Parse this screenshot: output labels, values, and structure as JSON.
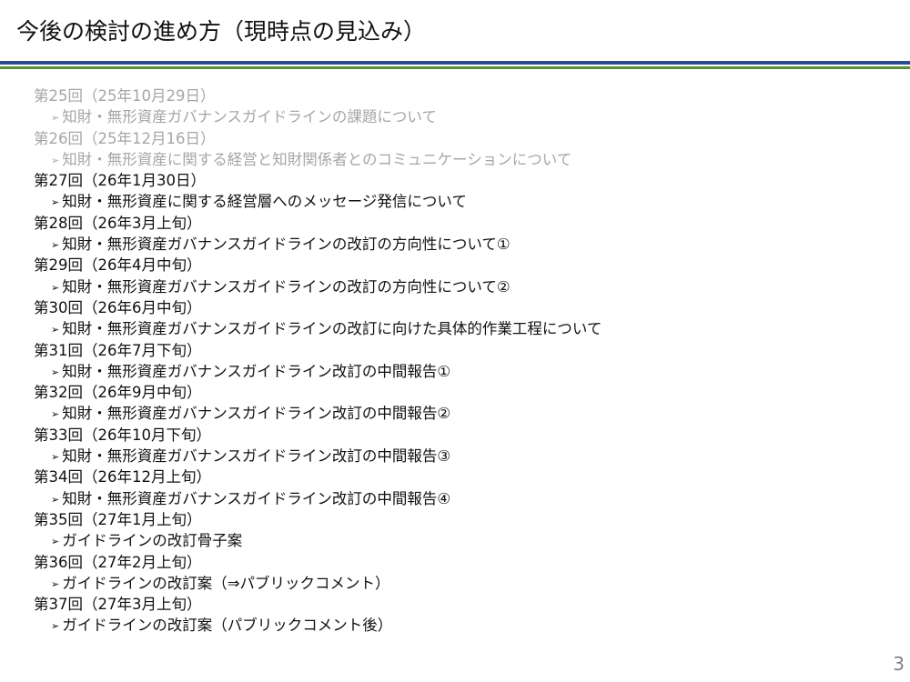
{
  "slide": {
    "title": "今後の検討の進め方（現時点の見込み）",
    "page_number": "3",
    "colors": {
      "rule_primary": "#2e4b8f",
      "rule_secondary": "#5a8f3a",
      "text": "#111111",
      "text_past": "#a6a6a6"
    },
    "bullet_symbol": "➢"
  },
  "agenda": [
    {
      "title": "第25回（25年10月29日）",
      "topic": "知財・無形資産ガバナンスガイドラインの課題について",
      "status": "past"
    },
    {
      "title": "第26回（25年12月16日）",
      "topic": "知財・無形資産に関する経営と知財関係者とのコミュニケーションについて",
      "status": "past"
    },
    {
      "title": "第27回（26年1月30日）",
      "topic": "知財・無形資産に関する経営層へのメッセージ発信について",
      "status": "upcoming"
    },
    {
      "title": "第28回（26年3月上旬）",
      "topic": "知財・無形資産ガバナンスガイドラインの改訂の方向性について①",
      "status": "upcoming"
    },
    {
      "title": "第29回（26年4月中旬）",
      "topic": "知財・無形資産ガバナンスガイドラインの改訂の方向性について②",
      "status": "upcoming"
    },
    {
      "title": "第30回（26年6月中旬）",
      "topic": "知財・無形資産ガバナンスガイドラインの改訂に向けた具体的作業工程について",
      "status": "upcoming"
    },
    {
      "title": "第31回（26年7月下旬）",
      "topic": "知財・無形資産ガバナンスガイドライン改訂の中間報告①",
      "status": "upcoming"
    },
    {
      "title": "第32回（26年9月中旬）",
      "topic": "知財・無形資産ガバナンスガイドライン改訂の中間報告②",
      "status": "upcoming"
    },
    {
      "title": "第33回（26年10月下旬）",
      "topic": "知財・無形資産ガバナンスガイドライン改訂の中間報告③",
      "status": "upcoming"
    },
    {
      "title": "第34回（26年12月上旬）",
      "topic": "知財・無形資産ガバナンスガイドライン改訂の中間報告④",
      "status": "upcoming"
    },
    {
      "title": "第35回（27年1月上旬）",
      "topic": "ガイドラインの改訂骨子案",
      "status": "upcoming"
    },
    {
      "title": "第36回（27年2月上旬）",
      "topic": "ガイドラインの改訂案（⇒パブリックコメント）",
      "status": "upcoming"
    },
    {
      "title": "第37回（27年3月上旬）",
      "topic": "ガイドラインの改訂案（パブリックコメント後）",
      "status": "upcoming"
    }
  ]
}
